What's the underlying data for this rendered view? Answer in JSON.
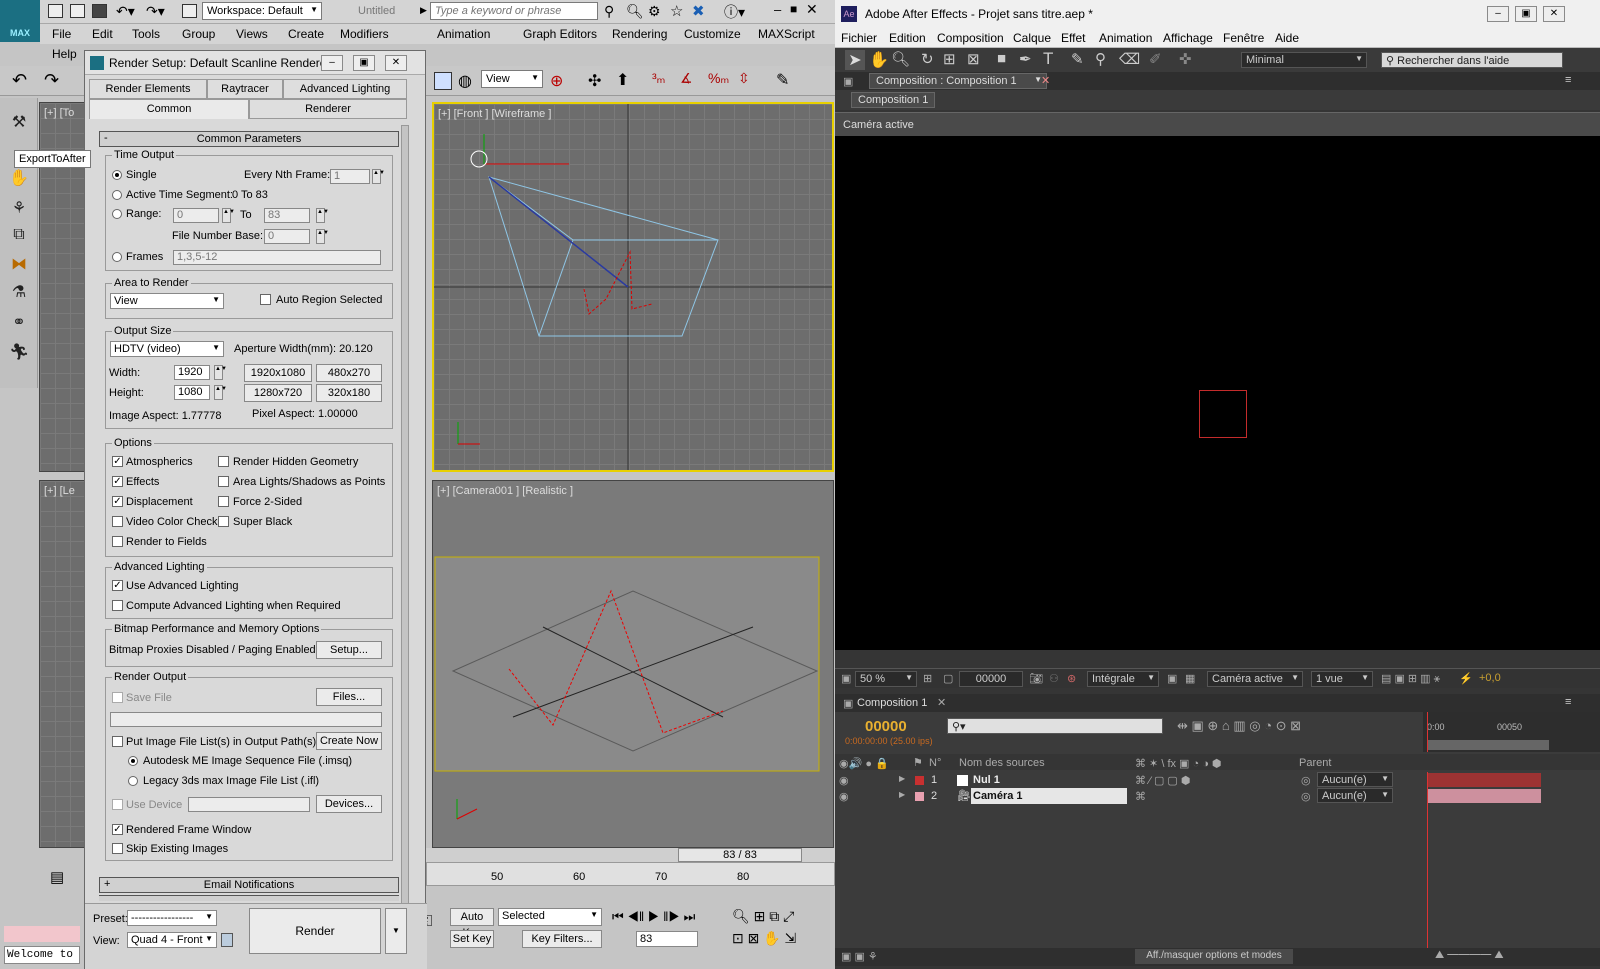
{
  "max": {
    "workspace": "Workspace: Default",
    "doc_title": "Untitled",
    "search_placeholder": "Type a keyword or phrase",
    "menu": [
      "File",
      "Edit",
      "Tools",
      "Group",
      "Views",
      "Create",
      "Modifiers",
      "Animation",
      "Graph Editors",
      "Rendering",
      "Customize",
      "MAXScript",
      "Help"
    ],
    "logo_text": "MAX",
    "tooltip": "ExportToAfter",
    "view_dd": "View",
    "viewports": {
      "top_left": "[+] [To",
      "left_bottom": "[+] [Le",
      "front": "[+] [Front ] [Wireframe ]",
      "camera": "[+] [Camera001 ] [Realistic ]"
    },
    "frame_counter": "83 / 83",
    "ruler": [
      "50",
      "60",
      "70",
      "80"
    ],
    "welcome": "Welcome to",
    "auto_key": "Auto Key",
    "set_key": "Set Key",
    "selected_dd": "Selected",
    "key_filters": "Key Filters...",
    "frame_field": "83"
  },
  "render": {
    "title": "Render Setup: Default Scanline Renderer",
    "tabs_row1": [
      "Render Elements",
      "Raytracer",
      "Advanced Lighting"
    ],
    "tabs_row2": [
      "Common",
      "Renderer"
    ],
    "rollout_common": "Common Parameters",
    "time_output": {
      "title": "Time Output",
      "single": "Single",
      "every_nth": "Every Nth Frame:",
      "every_nth_val": "1",
      "active_seg": "Active Time Segment:",
      "active_seg_val": "0 To 83",
      "range": "Range:",
      "range_from": "0",
      "range_to_lbl": "To",
      "range_to": "83",
      "file_num": "File Number Base:",
      "file_num_val": "0",
      "frames": "Frames",
      "frames_val": "1,3,5-12"
    },
    "area": {
      "title": "Area to Render",
      "view": "View",
      "auto_region": "Auto Region Selected"
    },
    "output_size": {
      "title": "Output Size",
      "preset": "HDTV (video)",
      "aperture": "Aperture Width(mm): 20.120",
      "width_lbl": "Width:",
      "width": "1920",
      "height_lbl": "Height:",
      "height": "1080",
      "presets": [
        "1920x1080",
        "480x270",
        "1280x720",
        "320x180"
      ],
      "image_aspect": "Image Aspect: 1.77778",
      "pixel_aspect_lbl": "Pixel Aspect:",
      "pixel_aspect": "1.00000"
    },
    "options": {
      "title": "Options",
      "items": [
        "Atmospherics",
        "Render Hidden Geometry",
        "Effects",
        "Area Lights/Shadows as Points",
        "Displacement",
        "Force 2-Sided",
        "Video Color Check",
        "Super Black",
        "Render to Fields"
      ]
    },
    "adv_lighting": {
      "title": "Advanced Lighting",
      "use": "Use Advanced Lighting",
      "compute": "Compute Advanced Lighting when Required"
    },
    "bitmap": {
      "title": "Bitmap Performance and Memory Options",
      "status": "Bitmap Proxies Disabled / Paging Enabled",
      "setup": "Setup..."
    },
    "render_output": {
      "title": "Render Output",
      "save_file": "Save File",
      "files": "Files...",
      "put_image": "Put Image File List(s) in Output Path(s)",
      "create_now": "Create Now",
      "autodesk": "Autodesk ME Image Sequence File (.imsq)",
      "legacy": "Legacy 3ds max Image File List (.ifl)",
      "use_device": "Use Device",
      "devices": "Devices...",
      "rendered_window": "Rendered Frame Window",
      "skip": "Skip Existing Images"
    },
    "email": "Email Notifications",
    "preset_lbl": "Preset:",
    "preset_val": "-----------------",
    "view_lbl": "View:",
    "view_val": "Quad 4 - Front",
    "render_btn": "Render"
  },
  "ae": {
    "title": "Adobe After Effects - Projet sans titre.aep *",
    "menu": [
      "Fichier",
      "Edition",
      "Composition",
      "Calque",
      "Effet",
      "Animation",
      "Affichage",
      "Fenêtre",
      "Aide"
    ],
    "workspace": "Minimal",
    "help_search": "Rechercher dans l'aide",
    "comp_panel_tab": "Composition : Composition 1",
    "comp_tab": "Composition 1",
    "camera_label": "Caméra active",
    "zoom": "50 %",
    "timecode_small": "00000",
    "resolution": "Intégrale",
    "view_mode": "Caméra active",
    "views": "1 vue",
    "exposure": "+0,0",
    "timeline_tab": "Composition 1",
    "timecode": "00000",
    "timecode_sub": "0:00:00:00 (25.00 ips)",
    "col_num": "N°",
    "col_name": "Nom des sources",
    "col_parent": "Parent",
    "ruler": [
      "0:00",
      "00050"
    ],
    "layers": [
      {
        "num": "1",
        "name": "Nul 1",
        "parent": "Aucun(e)",
        "color": "#c83030"
      },
      {
        "num": "2",
        "name": "Caméra 1",
        "parent": "Aucun(e)",
        "color": "#e8a0b0"
      }
    ],
    "bottom_toggle": "Aff./masquer options et modes"
  }
}
